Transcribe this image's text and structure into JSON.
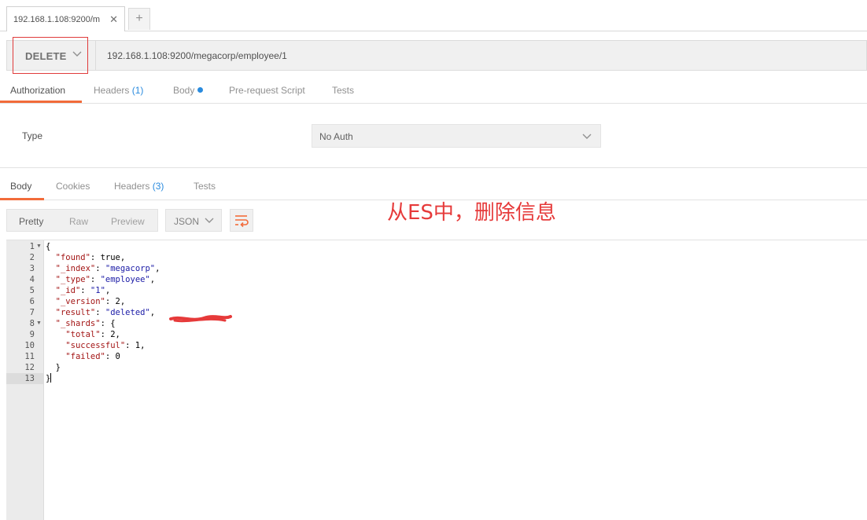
{
  "browser_tab": {
    "title": "192.168.1.108:9200/m",
    "close_glyph": "✕",
    "new_tab_glyph": "+"
  },
  "request": {
    "method": "DELETE",
    "url": "192.168.1.108:9200/megacorp/employee/1"
  },
  "request_tabs": {
    "authorization": "Authorization",
    "headers": "Headers",
    "headers_count": "(1)",
    "body": "Body",
    "prerequest": "Pre-request Script",
    "tests": "Tests",
    "active": "Authorization"
  },
  "auth": {
    "type_label": "Type",
    "type_value": "No Auth"
  },
  "response_tabs": {
    "body": "Body",
    "cookies": "Cookies",
    "headers": "Headers",
    "headers_count": "(3)",
    "tests": "Tests",
    "active": "Body"
  },
  "response_toolbar": {
    "pretty": "Pretty",
    "raw": "Raw",
    "preview": "Preview",
    "format": "JSON",
    "active": "Pretty"
  },
  "annotation": "从ES中，删除信息",
  "code_lines": [
    {
      "n": "1",
      "fold": true,
      "html": "{"
    },
    {
      "n": "2",
      "fold": false,
      "html": "  <span class=\"k\">\"found\"</span>: true,"
    },
    {
      "n": "3",
      "fold": false,
      "html": "  <span class=\"k\">\"_index\"</span>: <span class=\"s\">\"megacorp\"</span>,"
    },
    {
      "n": "4",
      "fold": false,
      "html": "  <span class=\"k\">\"_type\"</span>: <span class=\"s\">\"employee\"</span>,"
    },
    {
      "n": "5",
      "fold": false,
      "html": "  <span class=\"k\">\"_id\"</span>: <span class=\"s\">\"1\"</span>,"
    },
    {
      "n": "6",
      "fold": false,
      "html": "  <span class=\"k\">\"_version\"</span>: 2,"
    },
    {
      "n": "7",
      "fold": false,
      "html": "  <span class=\"k\">\"result\"</span>: <span class=\"s\">\"deleted\"</span>,"
    },
    {
      "n": "8",
      "fold": true,
      "html": "  <span class=\"k\">\"_shards\"</span>: {"
    },
    {
      "n": "9",
      "fold": false,
      "html": "    <span class=\"k\">\"total\"</span>: 2,"
    },
    {
      "n": "10",
      "fold": false,
      "html": "    <span class=\"k\">\"successful\"</span>: 1,"
    },
    {
      "n": "11",
      "fold": false,
      "html": "    <span class=\"k\">\"failed\"</span>: 0"
    },
    {
      "n": "12",
      "fold": false,
      "html": "  }"
    },
    {
      "n": "13",
      "fold": false,
      "html": "}"
    }
  ],
  "colors": {
    "accent": "#f26b3a",
    "count_blue": "#2a8bde",
    "annotation_red": "#e63a3a"
  },
  "icons": [
    "close-icon",
    "plus-icon",
    "chevron-down-icon",
    "wrap-lines-icon",
    "fold-arrow-icon"
  ]
}
